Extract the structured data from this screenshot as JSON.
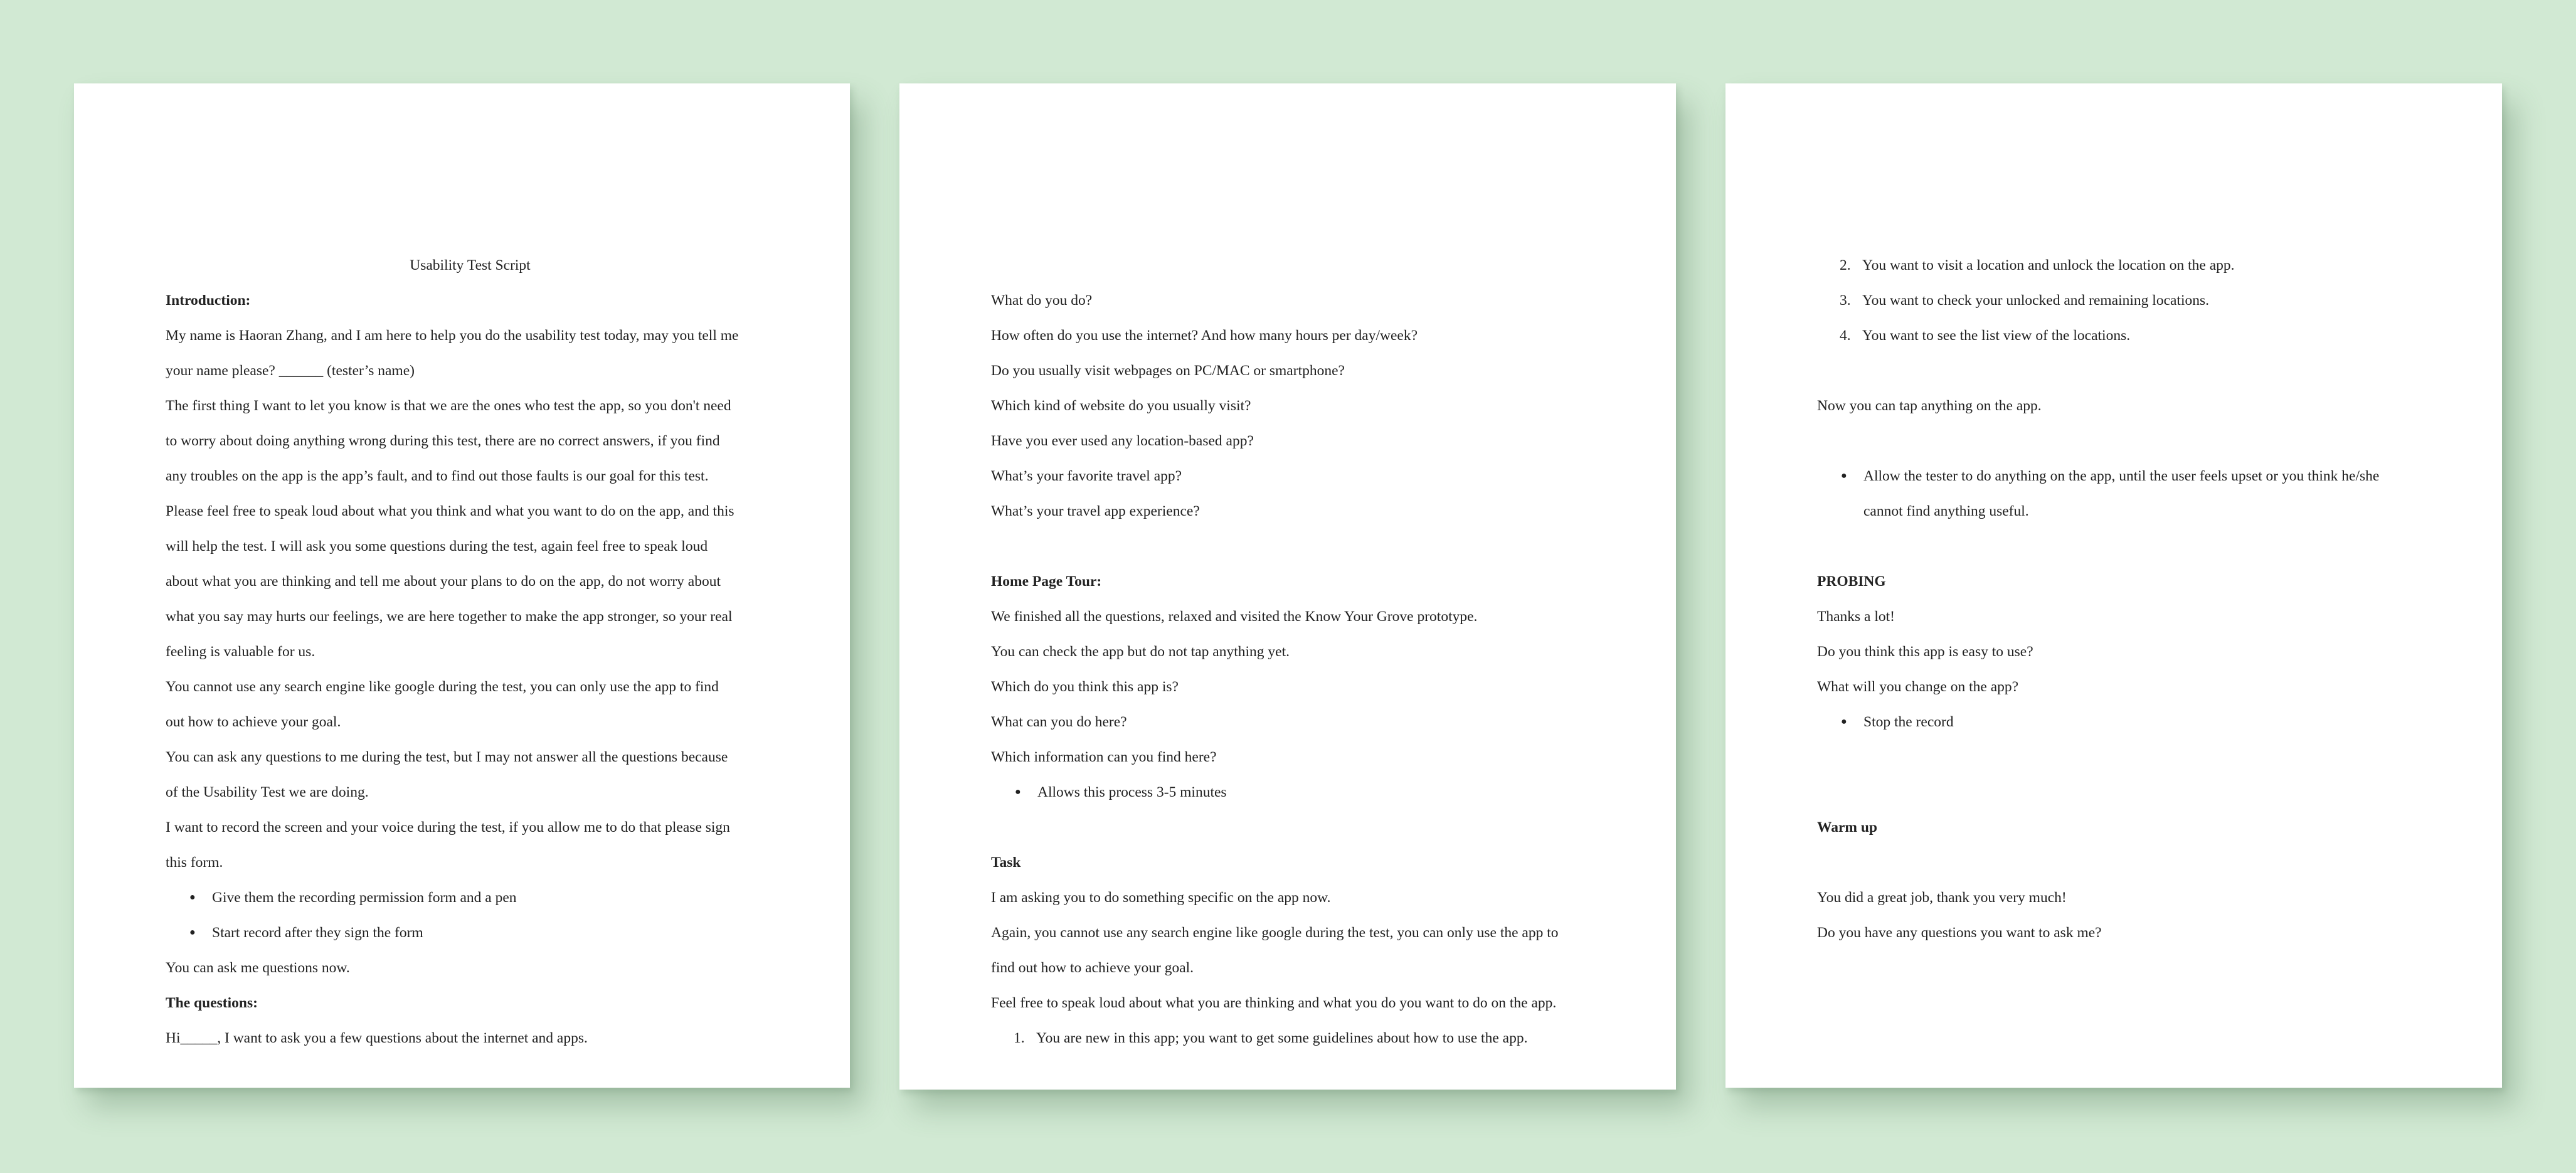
{
  "page1": {
    "title": "Usability Test Script",
    "intro_heading": "Introduction:",
    "lines": [
      "My name is Haoran Zhang, and I am here to help you do the usability test today, may you tell me",
      "your name please? ______ (tester’s name)",
      "The first thing I want to let you know is that we are the ones who test the app, so you don't need",
      "to worry about doing anything wrong during this test, there are no correct answers, if you find",
      "any troubles on the app is the app’s fault, and to find out those faults is our goal for this test.",
      "Please feel free to speak loud about what you think and what you want to do on the app, and this",
      "will help the test. I will ask you some questions during the test, again feel free to speak loud",
      "about what you are thinking and tell me about your plans to do on the app, do not worry about",
      "what you say may hurts our feelings, we are here together to make the app stronger, so your real",
      "feeling is valuable for us.",
      "You cannot use any search engine like google during the test, you can only use the app to find",
      "out how to achieve your goal.",
      "You can ask any questions to me during the test, but I may not answer all the questions because",
      "of the Usability Test we are doing.",
      "I want to record the screen and your voice during the test, if you allow me to do that please sign",
      "this form."
    ],
    "bullets": [
      "Give them the recording permission form and a pen",
      "Start record after they sign the form"
    ],
    "ask_line": "You can ask me questions now.",
    "questions_heading": "The questions:",
    "last_line": "Hi_____, I want to ask you a few questions about the internet and apps."
  },
  "page2": {
    "questions": [
      "What do you do?",
      "How often do you use the internet? And how many hours per day/week?",
      "Do you usually visit webpages on PC/MAC or smartphone?",
      "Which kind of website do you usually visit?",
      "Have you ever used any location-based app?",
      "What’s your favorite travel app?",
      "What’s your travel app experience?"
    ],
    "tour_heading": "Home Page Tour:",
    "tour_lines": [
      "We finished all the questions, relaxed and visited the Know Your Grove prototype.",
      "You can check the app but do not tap anything yet.",
      "Which do you think this app is?",
      "What can you do here?",
      "Which information can you find here?"
    ],
    "tour_bullet": "Allows this process 3-5 minutes",
    "task_heading": "Task",
    "task_lines": [
      "I am asking you to do something specific on the app now.",
      "Again, you cannot use any search engine like google during the test, you can only use the app to",
      "find out how to achieve your goal.",
      "Feel free to speak loud about what you are thinking and what you do you want to do on the app."
    ],
    "task_items": [
      {
        "num": "1.",
        "text": "You are new in this app; you want to get some guidelines about how to use the app."
      }
    ]
  },
  "page3": {
    "task_items": [
      {
        "num": "2.",
        "text": "You want to visit a location and unlock the location on the app."
      },
      {
        "num": "3.",
        "text": "You want to check your unlocked and remaining locations."
      },
      {
        "num": "4.",
        "text": "You want to see the list view of the locations."
      }
    ],
    "tap_line": "Now you can tap anything on the app.",
    "tap_bullet_lines": [
      "Allow the tester to do anything on the app, until the user feels upset or you think he/she",
      "cannot find anything useful."
    ],
    "probing_heading": "PROBING",
    "probing_lines": [
      "Thanks a lot!",
      "Do you think this app is easy to use?",
      "What will you change on the app?"
    ],
    "probing_bullet": "Stop the record",
    "warmup_heading": "Warm up",
    "closing_lines": [
      "You did a great job, thank you very much!",
      "Do you have any questions you want to ask me?"
    ]
  }
}
